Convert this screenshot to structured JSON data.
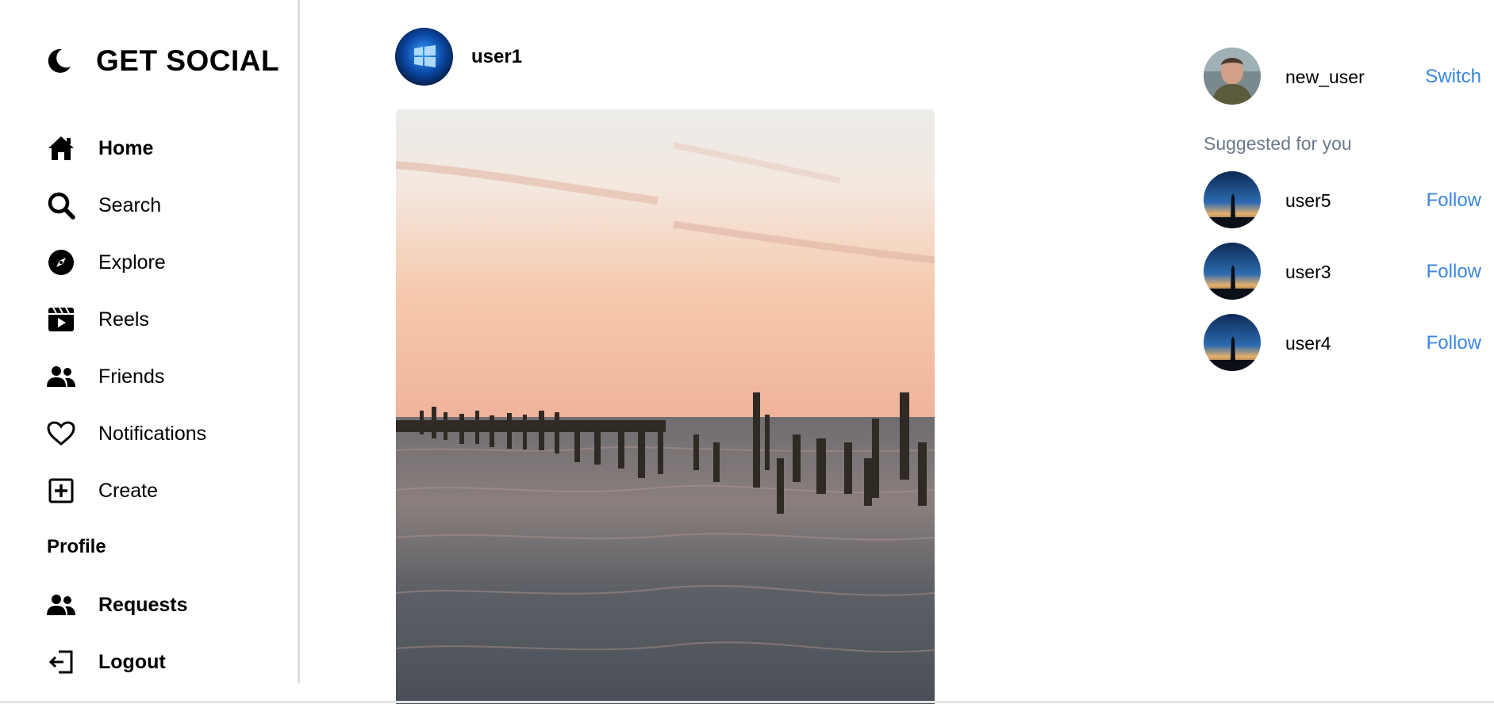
{
  "brand": {
    "title": "GET SOCIAL"
  },
  "nav": {
    "items": [
      {
        "label": "Home",
        "icon": "home-icon"
      },
      {
        "label": "Search",
        "icon": "search-icon"
      },
      {
        "label": "Explore",
        "icon": "compass-icon"
      },
      {
        "label": "Reels",
        "icon": "clapperboard-icon"
      },
      {
        "label": "Friends",
        "icon": "users-icon"
      },
      {
        "label": "Notifications",
        "icon": "heart-icon"
      },
      {
        "label": "Create",
        "icon": "plus-square-icon"
      }
    ],
    "profile_label": "Profile",
    "requests_label": "Requests",
    "logout_label": "Logout"
  },
  "post": {
    "username": "user1"
  },
  "current_user": {
    "username": "new_user",
    "action": "Switch"
  },
  "suggested": {
    "title": "Suggested for you",
    "users": [
      {
        "username": "user5",
        "action": "Follow"
      },
      {
        "username": "user3",
        "action": "Follow"
      },
      {
        "username": "user4",
        "action": "Follow"
      }
    ]
  },
  "colors": {
    "link": "#3a86e0",
    "muted": "#6b7a8b",
    "divider": "#dcdcdc"
  }
}
